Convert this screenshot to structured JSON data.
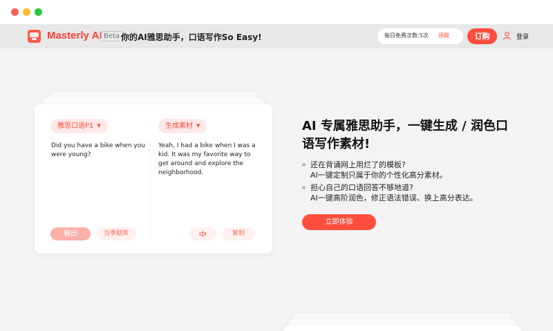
{
  "header": {
    "brand": "Masterly AI",
    "badge": "Beta",
    "slogan": "你的AI雅思助手，口语写作So Easy!",
    "quota_text": "每日免费次数:5次",
    "quota_claim": "领取",
    "subscribe": "订购",
    "login": "登录"
  },
  "demo": {
    "mode_select": "雅思口语P1",
    "output_select": "生成素材",
    "question": "Did you have a bike when you were young?",
    "answer": "Yeah, I had a bike when I was a kid. It was my favorite way to get around and explore the neighborhood.",
    "output_button": "输出",
    "bank_button": "当季题库",
    "copy_button": "复制"
  },
  "hero": {
    "title": "AI 专属雅思助手，一键生成 / 润色口语写作素材!",
    "bullet1_line1": "还在背诵网上用烂了的模板?",
    "bullet1_line2": "AI一键定制只属于你的个性化高分素材。",
    "bullet2_line1": "担心自己的口语回答不够地道?",
    "bullet2_line2": "AI一键高阶润色，修正语法错误、换上高分表达。",
    "cta": "立即体验"
  },
  "colors": {
    "accent": "#ff4e3e",
    "accent_light": "#ffe9e8",
    "background": "#f4f3f4"
  }
}
